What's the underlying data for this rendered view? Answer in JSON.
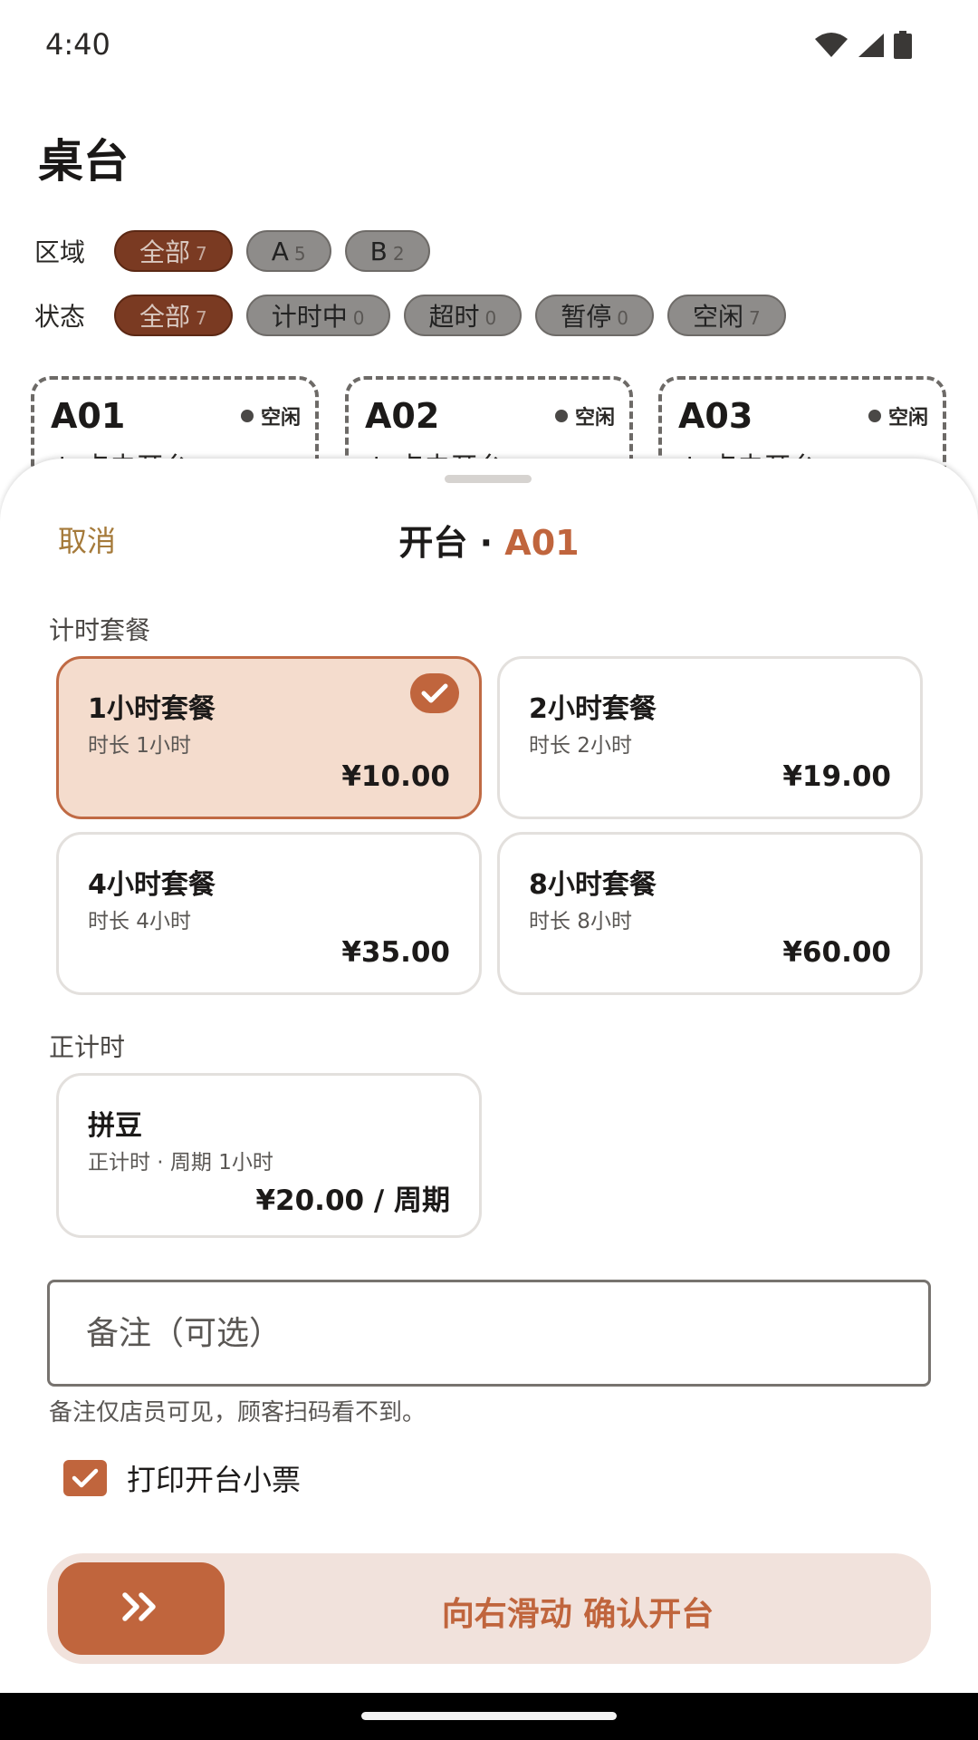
{
  "status_bar": {
    "time": "4:40"
  },
  "page": {
    "title": "桌台",
    "area_filter": {
      "label": "区域",
      "chips": [
        {
          "label": "全部",
          "count": "7",
          "active": true
        },
        {
          "label": "A",
          "count": "5",
          "active": false
        },
        {
          "label": "B",
          "count": "2",
          "active": false
        }
      ]
    },
    "status_filter": {
      "label": "状态",
      "chips": [
        {
          "label": "全部",
          "count": "7",
          "active": true
        },
        {
          "label": "计时中",
          "count": "0",
          "active": false
        },
        {
          "label": "超时",
          "count": "0",
          "active": false
        },
        {
          "label": "暂停",
          "count": "0",
          "active": false
        },
        {
          "label": "空闲",
          "count": "7",
          "active": false
        }
      ]
    },
    "tables": [
      {
        "name": "A01",
        "status": "空闲",
        "action": "↓ 点击开台"
      },
      {
        "name": "A02",
        "status": "空闲",
        "action": "↓ 点击开台"
      },
      {
        "name": "A03",
        "status": "空闲",
        "action": "↓ 点击开台"
      }
    ]
  },
  "sheet": {
    "cancel_label": "取消",
    "title_prefix": "开台 · ",
    "title_table": "A01",
    "timed_section_label": "计时套餐",
    "packages": [
      {
        "name": "1小时套餐",
        "desc": "时长 1小时",
        "price": "¥10.00",
        "selected": true
      },
      {
        "name": "2小时套餐",
        "desc": "时长 2小时",
        "price": "¥19.00",
        "selected": false
      },
      {
        "name": "4小时套餐",
        "desc": "时长 4小时",
        "price": "¥35.00",
        "selected": false
      },
      {
        "name": "8小时套餐",
        "desc": "时长 8小时",
        "price": "¥60.00",
        "selected": false
      }
    ],
    "countup_section_label": "正计时",
    "countup_packages": [
      {
        "name": "拼豆",
        "desc": "正计时 · 周期 1小时",
        "price": "¥20.00 / 周期",
        "selected": false
      }
    ],
    "note_placeholder": "备注（可选）",
    "note_hint": "备注仅店员可见，顾客扫码看不到。",
    "print_label": "打印开台小票",
    "print_checked": true,
    "slider_label": "向右滑动 确认开台"
  },
  "colors": {
    "accent": "#c0653d",
    "accent_light": "#f4dccd",
    "cancel": "#a57a3a"
  },
  "icons": [
    "wifi-icon",
    "signal-icon",
    "battery-icon",
    "check-icon",
    "double-chevron-right-icon"
  ]
}
